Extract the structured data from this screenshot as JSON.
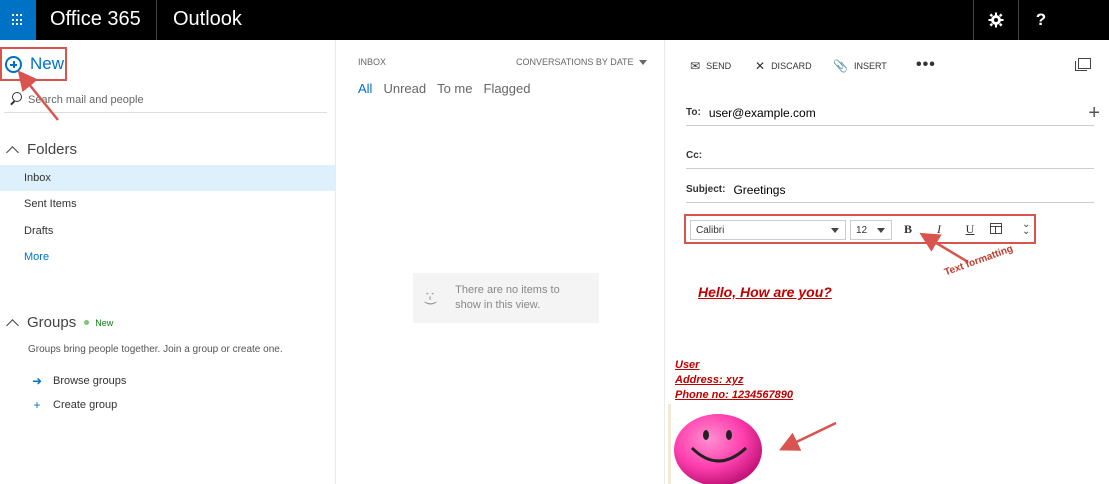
{
  "topbar": {
    "brand": "Office 365",
    "app_name": "Outlook",
    "settings_icon": "gear-icon",
    "help_label": "?"
  },
  "leftpane": {
    "new_label": "New",
    "search_placeholder": "Search mail and people",
    "folders_heading": "Folders",
    "folders": [
      {
        "label": "Inbox",
        "selected": true
      },
      {
        "label": "Sent Items",
        "selected": false
      },
      {
        "label": "Drafts",
        "selected": false
      }
    ],
    "more_label": "More",
    "groups_heading": "Groups",
    "groups_badge": "New",
    "groups_description": "Groups bring people together. Join a group or create one.",
    "browse_groups": "Browse groups",
    "create_group": "Create group"
  },
  "midpane": {
    "inbox_label": "INBOX",
    "sort_label": "CONVERSATIONS BY DATE",
    "filters": [
      "All",
      "Unread",
      "To me",
      "Flagged"
    ],
    "empty_icon": ":-)",
    "empty_text": "There are no items to show in this view."
  },
  "compose": {
    "send_label": "SEND",
    "discard_label": "DISCARD",
    "insert_label": "INSERT",
    "more_label": "•••",
    "to_label": "To:",
    "to_value": "user@example.com",
    "cc_label": "Cc:",
    "cc_value": "",
    "subject_label": "Subject:",
    "subject_value": "Greetings",
    "font_value": "Calibri",
    "size_value": "12",
    "bold_label": "B",
    "italic_label": "I",
    "underline_label": "U",
    "body_text": "Hello, How are you?",
    "signature": {
      "name": "User",
      "address": "Address: xyz",
      "phone": "Phone no: 1234567890"
    }
  },
  "annotations": {
    "text_formatting_label": "Text formatting",
    "arrow_color": "#d9534f"
  },
  "colors": {
    "accent": "#0072c6",
    "topbar": "#000000",
    "selected_row": "#def0fb",
    "signature_red": "#c00000"
  }
}
